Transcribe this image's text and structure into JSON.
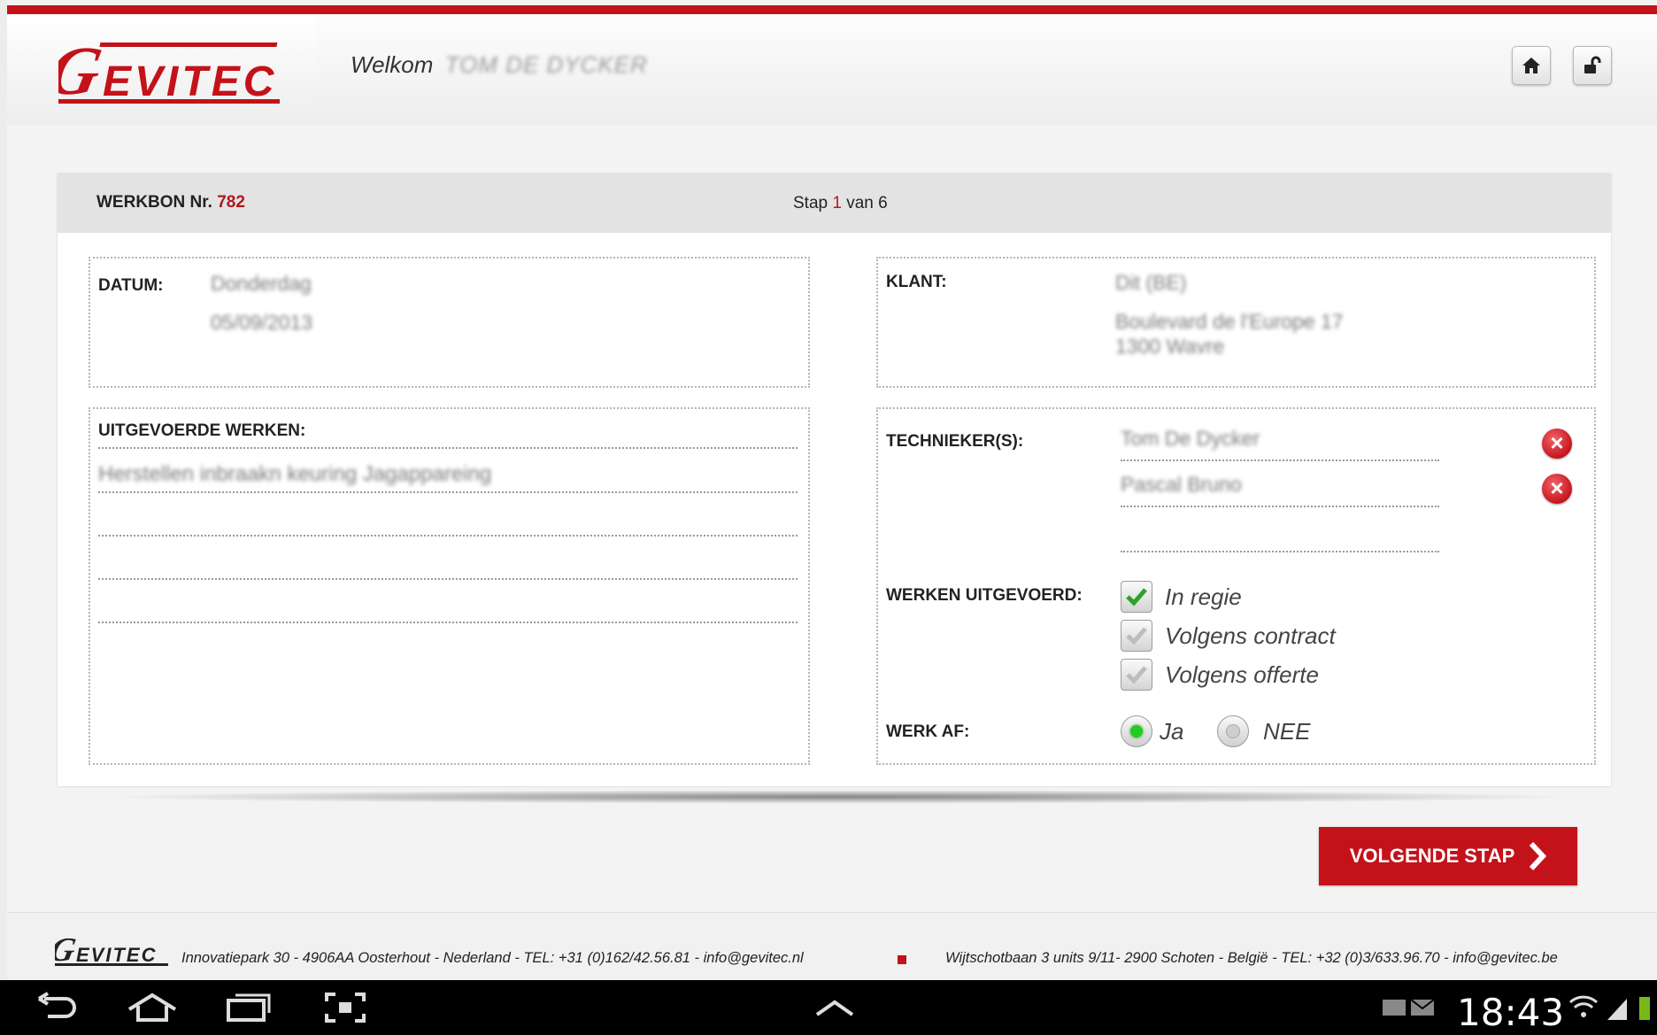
{
  "header": {
    "welcome_label": "Welkom",
    "user_name": "TOM DE DYCKER"
  },
  "form": {
    "title_prefix": "WERKBON Nr.",
    "number": "782",
    "step_prefix": "Stap",
    "step_current": "1",
    "step_sep": "van",
    "step_total": "6"
  },
  "datum": {
    "label": "DATUM:",
    "day": "Donderdag",
    "date": "05/09/2013"
  },
  "klant": {
    "label": "KLANT:",
    "name": "Dit (BE)",
    "address_line1": "Boulevard de l'Europe 17",
    "address_line2": "1300 Wavre"
  },
  "werken": {
    "label": "UITGEVOERDE WERKEN:",
    "line1": "Herstellen inbraakn keuring Jagappareing"
  },
  "technieker": {
    "label": "TECHNIEKER(S):",
    "names": [
      "Tom De Dycker",
      "Pascal Bruno"
    ]
  },
  "werken_uitgevoerd": {
    "label": "WERKEN UITGEVOERD:",
    "options": [
      {
        "label": "In regie",
        "checked": true
      },
      {
        "label": "Volgens contract",
        "checked": false
      },
      {
        "label": "Volgens offerte",
        "checked": false
      }
    ]
  },
  "werk_af": {
    "label": "WERK AF:",
    "yes": "Ja",
    "no": "NEE",
    "selected": "Ja"
  },
  "actions": {
    "next_label": "VOLGENDE STAP"
  },
  "footer": {
    "address_nl": "Innovatiepark 30 - 4906AA Oosterhout - Nederland - TEL: +31 (0)162/42.56.81 - info@gevitec.nl",
    "address_be": "Wijtschotbaan 3 units 9/11- 2900 Schoten - België - TEL: +32 (0)3/633.96.70  - info@gevitec.be"
  },
  "system": {
    "time": "18:43"
  },
  "colors": {
    "brand_red": "#c4121a",
    "check_green": "#2aa42a"
  }
}
